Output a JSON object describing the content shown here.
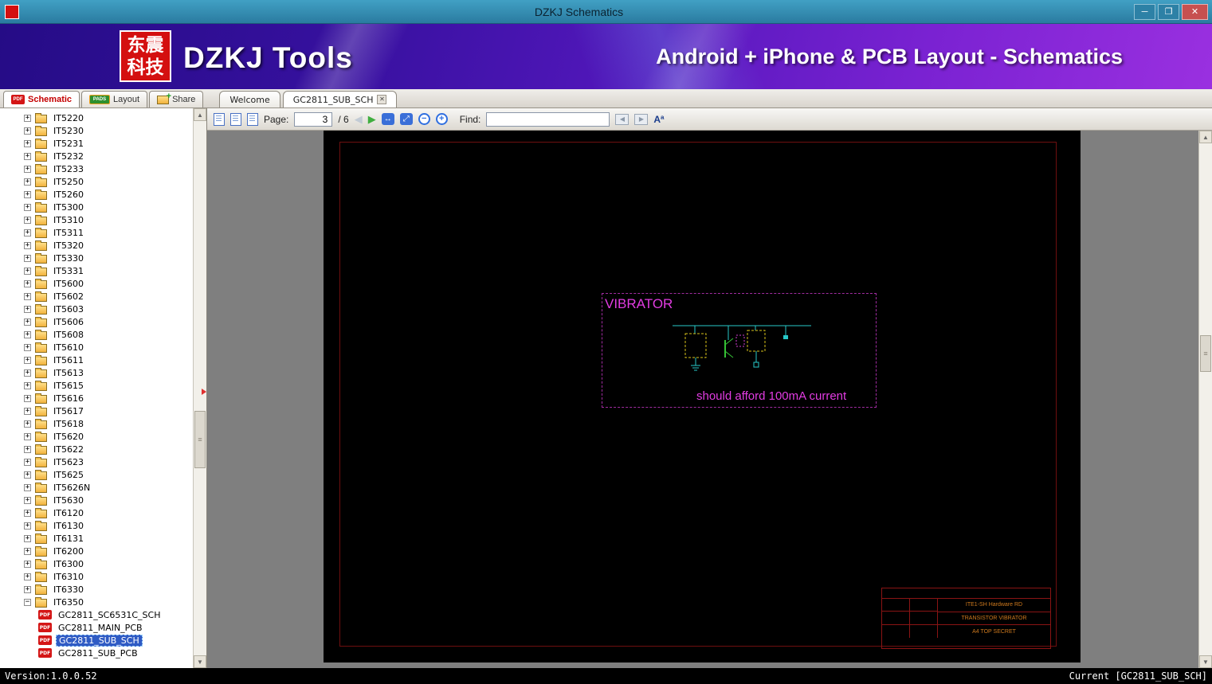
{
  "window": {
    "title": "DZKJ Schematics"
  },
  "titlebar": {
    "minimize_glyph": "─",
    "maximize_glyph": "❐",
    "close_glyph": "✕"
  },
  "banner": {
    "logo_top": "东震",
    "logo_bottom": "科技",
    "brand": "DZKJ Tools",
    "subtitle": "Android + iPhone & PCB Layout - Schematics"
  },
  "app_tabs": [
    {
      "label": "Schematic",
      "icon": "PDF"
    },
    {
      "label": "Layout",
      "icon": "PADS"
    },
    {
      "label": "Share"
    }
  ],
  "doc_tabs": {
    "welcome": "Welcome",
    "active": "GC2811_SUB_SCH",
    "close_glyph": "✕"
  },
  "toolbar": {
    "page_label": "Page:",
    "page_value": "3",
    "page_total": "/ 6",
    "prev_glyph": "◀",
    "next_glyph": "▶",
    "fit_width_glyph": "↔",
    "fit_page_glyph": "⤢",
    "zoom_out_glyph": "−",
    "zoom_in_glyph": "+",
    "find_label": "Find:",
    "find_value": "",
    "find_prev_glyph": "◀",
    "find_next_glyph": "▶",
    "font_glyph": "Aª"
  },
  "sidebar": {
    "pdf_badge": "PDF",
    "folders": [
      "IT5220",
      "IT5230",
      "IT5231",
      "IT5232",
      "IT5233",
      "IT5250",
      "IT5260",
      "IT5300",
      "IT5310",
      "IT5311",
      "IT5320",
      "IT5330",
      "IT5331",
      "IT5600",
      "IT5602",
      "IT5603",
      "IT5606",
      "IT5608",
      "IT5610",
      "IT5611",
      "IT5613",
      "IT5615",
      "IT5616",
      "IT5617",
      "IT5618",
      "IT5620",
      "IT5622",
      "IT5623",
      "IT5625",
      "IT5626N",
      "IT5630",
      "IT6120",
      "IT6130",
      "IT6131",
      "IT6200",
      "IT6300",
      "IT6310",
      "IT6330"
    ],
    "expanded_folder": "IT6350",
    "files": [
      {
        "label": "GC2811_SC6531C_SCH",
        "selected": false
      },
      {
        "label": "GC2811_MAIN_PCB",
        "selected": false
      },
      {
        "label": "GC2811_SUB_SCH",
        "selected": true
      },
      {
        "label": "GC2811_SUB_PCB",
        "selected": false
      }
    ]
  },
  "schematic": {
    "region_title": "VIBRATOR",
    "note": "should afford 100mA current",
    "titleblock": {
      "company": "ITE1-SH Hardware RD",
      "sheet_title": "TRANSISTOR VIBRATOR",
      "size_secrecy": "A4   TOP SECRET"
    }
  },
  "scrollbar": {
    "up": "▲",
    "down": "▼",
    "grip": "≡"
  },
  "statusbar": {
    "version": "Version:1.0.0.52",
    "current": "Current [GC2811_SUB_SCH]"
  }
}
